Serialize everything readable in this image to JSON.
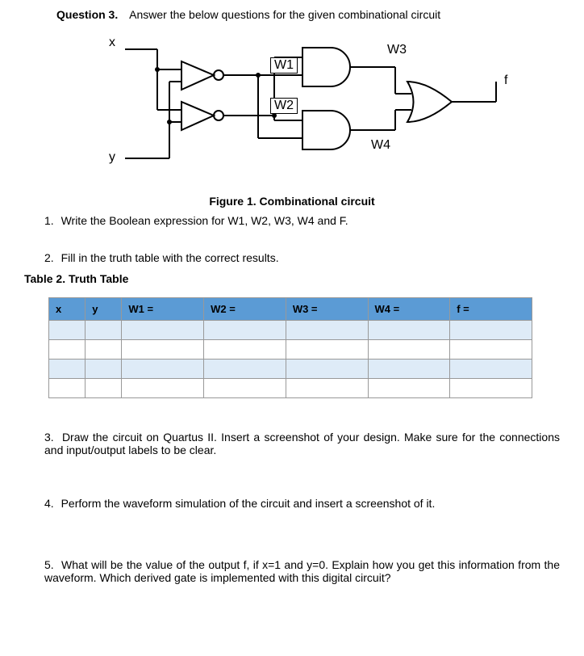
{
  "header": {
    "question_label": "Question 3.",
    "question_text": "Answer the below questions for the given combinational circuit"
  },
  "circuit": {
    "input_x": "x",
    "input_y": "y",
    "w1_label": "W1",
    "w2_label": "W2",
    "w3_label": "W3",
    "w4_label": "W4",
    "output_f": "f",
    "caption": "Figure 1. Combinational circuit"
  },
  "items": {
    "item1_num": "1.",
    "item1_text": "Write the Boolean expression for W1, W2, W3, W4 and F.",
    "item2_num": "2.",
    "item2_text": "Fill in the truth table with the correct results.",
    "item3_num": "3.",
    "item3_text": "Draw the circuit on Quartus II. Insert a screenshot of your design.  Make sure for the connections and input/output labels to be clear.",
    "item4_num": "4.",
    "item4_text": "Perform the waveform simulation of the circuit and insert a screenshot of it.",
    "item5_num": "5.",
    "item5_text": "What will be the value of the output f, if x=1 and y=0. Explain how you get this information from the waveform.  Which derived gate is implemented with this digital circuit?"
  },
  "table": {
    "caption": "Table 2. Truth Table",
    "headers": {
      "x": "x",
      "y": "y",
      "w1": "W1 =",
      "w2": "W2 =",
      "w3": "W3 =",
      "w4": "W4 =",
      "f": "f ="
    }
  }
}
